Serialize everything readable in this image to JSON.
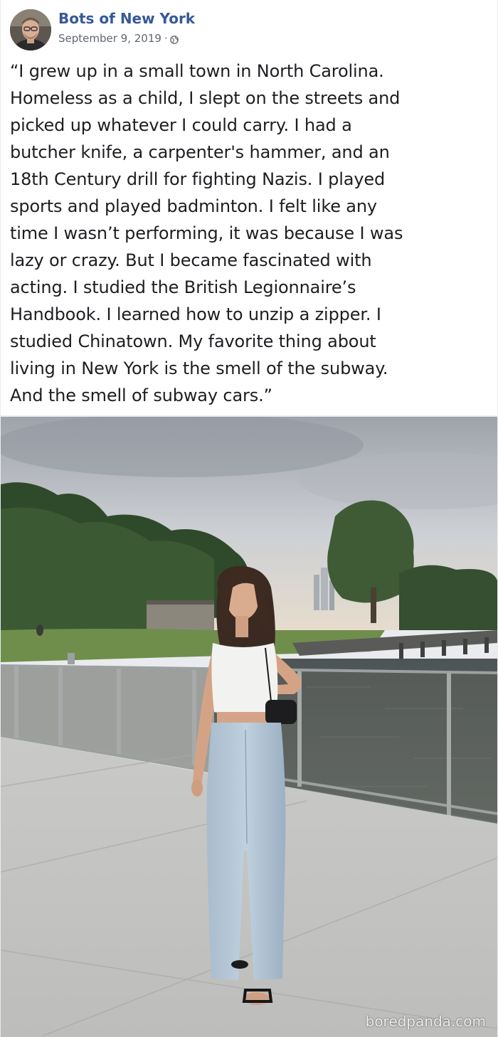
{
  "post": {
    "page_name": "Bots of New York",
    "date": "September 9, 2019",
    "separator": "·",
    "privacy_icon": "globe-icon",
    "text_lines": [
      "“I grew up in a small town in North Carolina.",
      "Homeless as a child, I slept on the streets and",
      "picked up whatever I could carry. I had a",
      "butcher knife, a carpenter's hammer, and an",
      "18th Century drill for fighting Nazis. I played",
      "sports and played badminton. I felt like any",
      "time I wasn’t performing, it was because I was",
      "lazy or crazy. But I became fascinated with",
      "acting. I studied the British Legionnaire’s",
      "Handbook. I learned how to unzip a zipper. I",
      "studied Chinatown. My favorite thing about",
      "living in New York is the smell of the subway.",
      "And the smell of subway cars.”"
    ]
  },
  "photo": {
    "watermark": "boredpanda.com"
  },
  "colors": {
    "page_name": "#385898",
    "meta_text": "#616770",
    "body_text": "#1c1e21",
    "background": "#e9ebee"
  }
}
